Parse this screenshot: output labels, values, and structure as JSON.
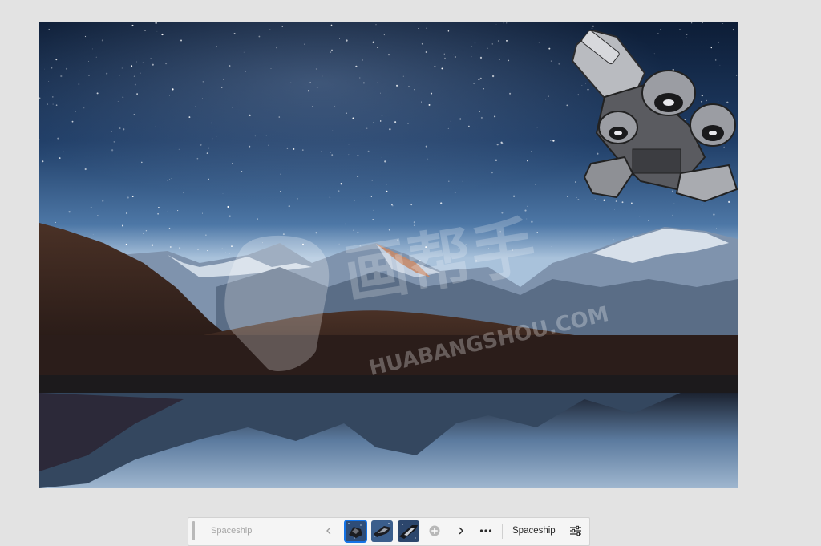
{
  "canvas": {
    "watermark_text": "HUABANGSHOU.COM",
    "watermark_logo_text": "画帮手"
  },
  "taskbar": {
    "prompt_placeholder": "Spaceship",
    "prev_icon": "chevron-left-icon",
    "next_icon": "chevron-right-icon",
    "add_icon": "plus-circle-icon",
    "more_icon": "ellipsis-icon",
    "generate_label": "Spaceship",
    "settings_icon": "sliders-icon",
    "variations": [
      {
        "selected": true
      },
      {
        "selected": false
      },
      {
        "selected": false
      }
    ]
  }
}
